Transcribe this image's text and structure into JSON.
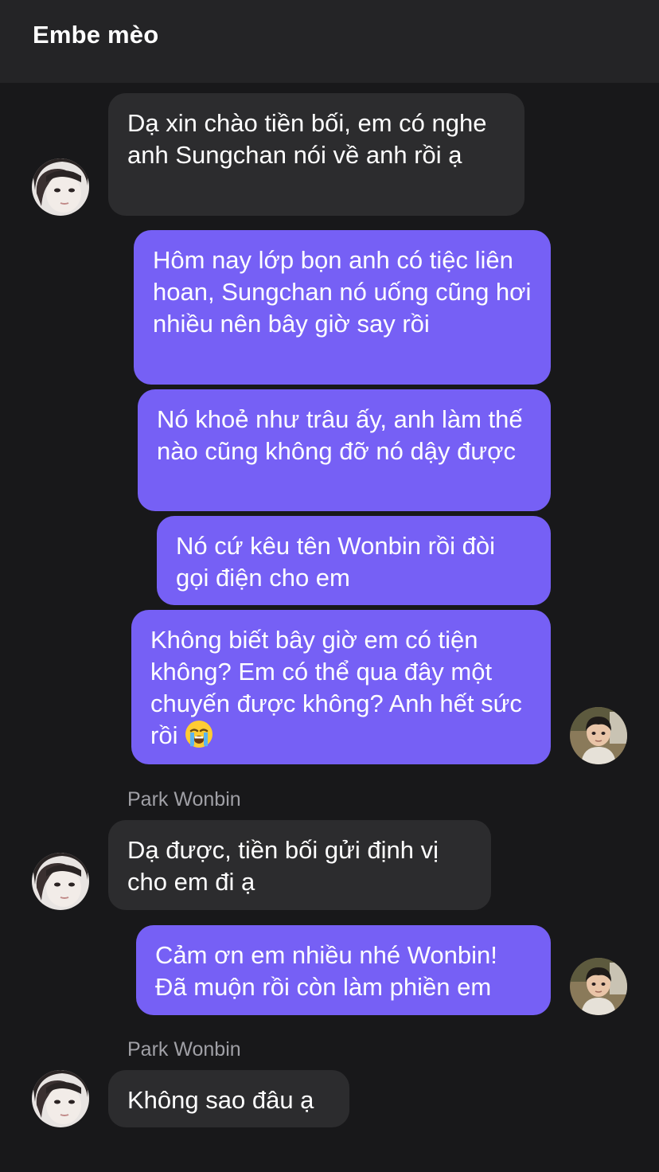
{
  "header": {
    "title": "Embe mèo"
  },
  "messages": [
    {
      "text": "Dạ xin chào tiền bối, em có nghe anh Sungchan nói về anh rồi ạ"
    },
    {
      "text": "Hôm nay lớp bọn anh có tiệc liên hoan, Sungchan nó uống cũng hơi nhiều nên bây giờ say rồi"
    },
    {
      "text": "Nó khoẻ như trâu ấy, anh làm thế nào cũng không đỡ nó dậy được"
    },
    {
      "text": "Nó cứ kêu tên Wonbin rồi đòi gọi điện cho em"
    },
    {
      "text": "Không biết bây giờ em có tiện không? Em có thể qua đây một chuyến được không? Anh hết sức rồi",
      "emoji": "loudly-crying-face"
    },
    {
      "sender": "Park Wonbin",
      "text": "Dạ được, tiền bối gửi định vị cho em đi ạ"
    },
    {
      "text": "Cảm ơn em nhiều nhé Wonbin! Đã muộn rồi còn làm phiền em"
    },
    {
      "sender": "Park Wonbin",
      "text": "Không sao đâu ạ"
    }
  ],
  "colors": {
    "background": "#18181a",
    "header": "#242426",
    "incoming_bubble": "#2c2c2e",
    "outgoing_bubble": "#7660f5",
    "sender_name": "#a0a0a6"
  }
}
